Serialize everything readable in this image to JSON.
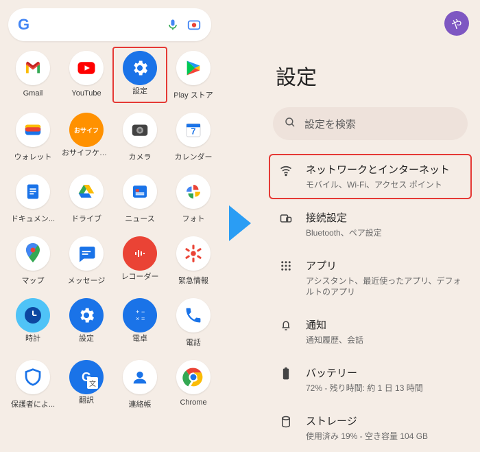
{
  "left": {
    "search": {
      "placeholder": ""
    },
    "apps": [
      {
        "id": "gmail",
        "label": "Gmail"
      },
      {
        "id": "youtube",
        "label": "YouTube"
      },
      {
        "id": "settings",
        "label": "設定",
        "highlighted": true
      },
      {
        "id": "playstore",
        "label": "Play ストア"
      },
      {
        "id": "wallet",
        "label": "ウォレット"
      },
      {
        "id": "osaifu",
        "label": "おサイフケータイ"
      },
      {
        "id": "camera",
        "label": "カメラ"
      },
      {
        "id": "calendar",
        "label": "カレンダー"
      },
      {
        "id": "docs",
        "label": "ドキュメン..."
      },
      {
        "id": "drive",
        "label": "ドライブ"
      },
      {
        "id": "news",
        "label": "ニュース"
      },
      {
        "id": "photos",
        "label": "フォト"
      },
      {
        "id": "maps",
        "label": "マップ"
      },
      {
        "id": "messages",
        "label": "メッセージ"
      },
      {
        "id": "recorder",
        "label": "レコーダー"
      },
      {
        "id": "emergency",
        "label": "緊急情報"
      },
      {
        "id": "clock",
        "label": "時計"
      },
      {
        "id": "settings2",
        "label": "設定"
      },
      {
        "id": "calculator",
        "label": "電卓"
      },
      {
        "id": "phone",
        "label": "電話"
      },
      {
        "id": "guardian",
        "label": "保護者によ..."
      },
      {
        "id": "translate",
        "label": "翻訳"
      },
      {
        "id": "contacts",
        "label": "連絡帳"
      },
      {
        "id": "chrome",
        "label": "Chrome"
      }
    ]
  },
  "right": {
    "avatar_initial": "や",
    "title": "設定",
    "search_placeholder": "設定を検索",
    "rows": [
      {
        "id": "network",
        "title": "ネットワークとインターネット",
        "sub": "モバイル、Wi-Fi、アクセス ポイント",
        "highlighted": true
      },
      {
        "id": "connected",
        "title": "接続設定",
        "sub": "Bluetooth、ペア設定"
      },
      {
        "id": "apps",
        "title": "アプリ",
        "sub": "アシスタント、最近使ったアプリ、デフォルトのアプリ"
      },
      {
        "id": "notifications",
        "title": "通知",
        "sub": "通知履歴、会話"
      },
      {
        "id": "battery",
        "title": "バッテリー",
        "sub": "72% - 残り時間: 約 1 日 13 時間"
      },
      {
        "id": "storage",
        "title": "ストレージ",
        "sub": "使用済み 19% - 空き容量 104 GB"
      }
    ]
  }
}
